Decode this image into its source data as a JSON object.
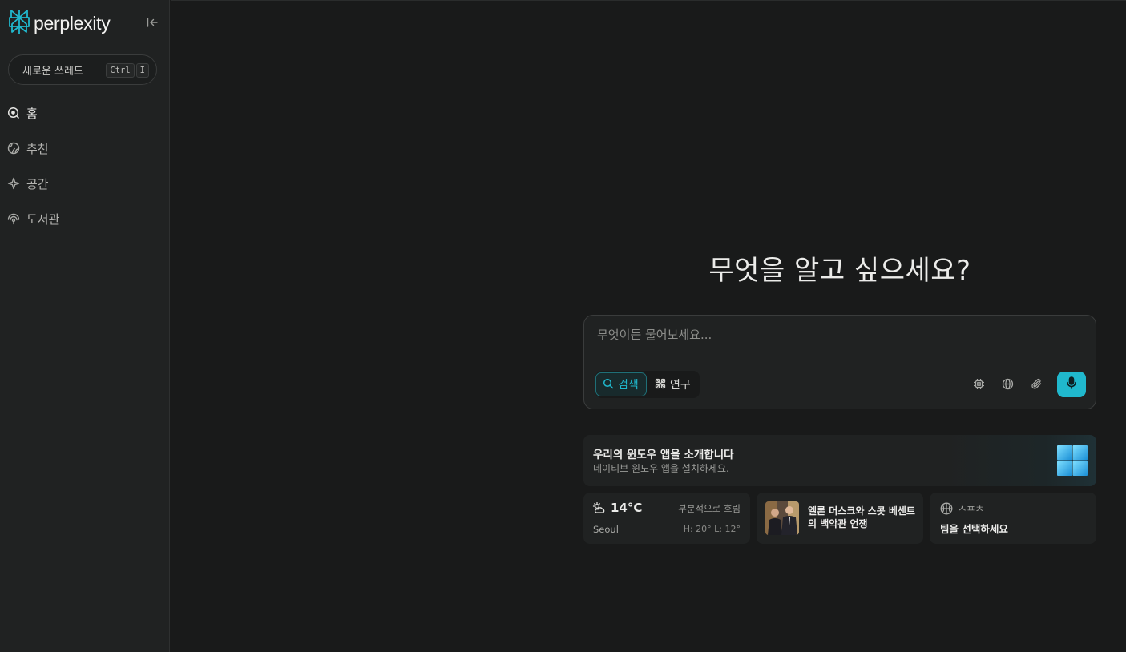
{
  "sidebar": {
    "logo_text": "perplexity",
    "collapse_icon": "collapse-left-icon",
    "new_thread": {
      "label": "새로운 쓰레드",
      "shortcut": [
        "Ctrl",
        "I"
      ]
    },
    "nav": [
      {
        "label": "홈",
        "icon": "home-search-icon",
        "active": true
      },
      {
        "label": "추천",
        "icon": "globe-icon",
        "active": false
      },
      {
        "label": "공간",
        "icon": "sparkle-icon",
        "active": false
      },
      {
        "label": "도서관",
        "icon": "library-icon",
        "active": false
      }
    ]
  },
  "main": {
    "headline": "무엇을 알고 싶으세요?",
    "search": {
      "placeholder": "무엇이든 물어보세요...",
      "modes": [
        {
          "label": "검색",
          "icon": "search-icon",
          "selected": true
        },
        {
          "label": "연구",
          "icon": "research-icon",
          "selected": false
        }
      ],
      "tools": [
        "model-chip-icon",
        "globe-icon",
        "attach-icon"
      ],
      "mic_icon": "microphone-icon"
    },
    "promo": {
      "title": "우리의 윈도우 앱을 소개합니다",
      "subtitle": "네이티브 윈도우 앱을 설치하세요.",
      "logo": "windows-logo"
    },
    "weather": {
      "temperature": "14°C",
      "condition": "부분적으로 흐림",
      "city": "Seoul",
      "hilo": "H: 20° L: 12°",
      "icon": "partly-cloudy-icon"
    },
    "news": {
      "title": "엘론 머스크와 스콧 베센트의 백악관 언쟁",
      "thumb": "news-photo"
    },
    "sports": {
      "label": "스포츠",
      "title": "팀을 선택하세요",
      "icon": "basketball-icon"
    }
  },
  "colors": {
    "accent": "#20b8cd",
    "background": "#191a1a",
    "sidebar": "#202222"
  }
}
